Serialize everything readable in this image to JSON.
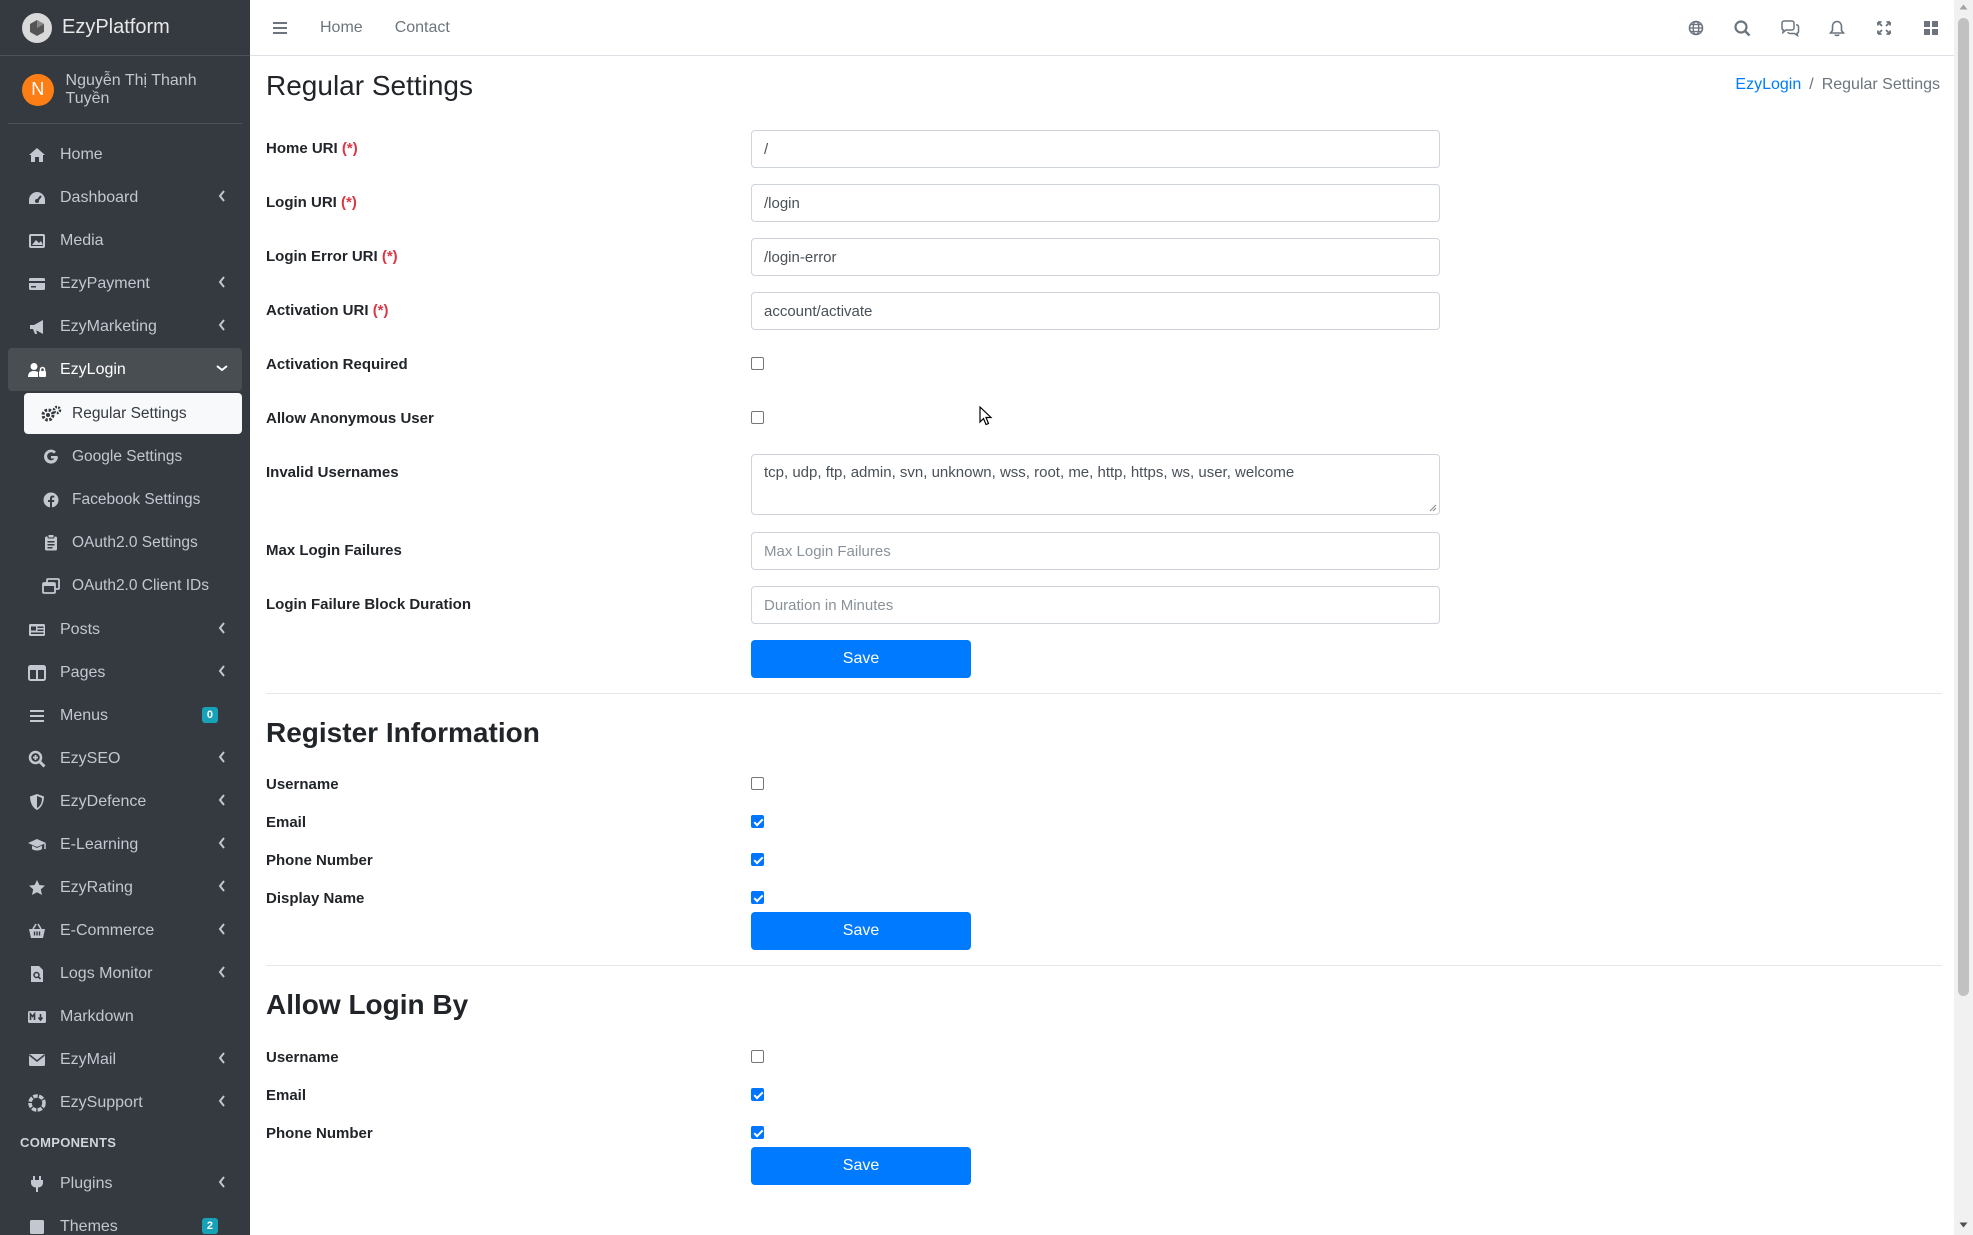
{
  "brand": {
    "name": "EzyPlatform"
  },
  "user": {
    "initial": "N",
    "name": "Nguyễn Thị Thanh Tuyền"
  },
  "sidebar": {
    "items": [
      {
        "label": "Home",
        "icon": "home-icon"
      },
      {
        "label": "Dashboard",
        "icon": "gauge-icon"
      },
      {
        "label": "Media",
        "icon": "image-icon"
      },
      {
        "label": "EzyPayment",
        "icon": "credit-card-icon"
      },
      {
        "label": "EzyMarketing",
        "icon": "megaphone-icon"
      },
      {
        "label": "EzyLogin",
        "icon": "user-lock-icon"
      }
    ],
    "sub_items": [
      {
        "label": "Regular Settings",
        "icon": "gears-icon"
      },
      {
        "label": "Google Settings",
        "icon": "google-icon"
      },
      {
        "label": "Facebook Settings",
        "icon": "facebook-icon"
      },
      {
        "label": "OAuth2.0 Settings",
        "icon": "clipboard-icon"
      },
      {
        "label": "OAuth2.0 Client IDs",
        "icon": "window-restore-icon"
      }
    ],
    "items2": [
      {
        "label": "Posts",
        "icon": "newspaper-icon"
      },
      {
        "label": "Pages",
        "icon": "columns-icon"
      },
      {
        "label": "Menus",
        "icon": "bars-icon",
        "badge": "0"
      },
      {
        "label": "EzySEO",
        "icon": "search-plus-icon"
      },
      {
        "label": "EzyDefence",
        "icon": "shield-icon"
      },
      {
        "label": "E-Learning",
        "icon": "graduation-cap-icon"
      },
      {
        "label": "EzyRating",
        "icon": "star-icon"
      },
      {
        "label": "E-Commerce",
        "icon": "basket-icon"
      },
      {
        "label": "Logs Monitor",
        "icon": "file-search-icon"
      },
      {
        "label": "Markdown",
        "icon": "markdown-icon"
      },
      {
        "label": "EzyMail",
        "icon": "envelope-icon"
      },
      {
        "label": "EzySupport",
        "icon": "life-ring-icon"
      }
    ],
    "components_header": "COMPONENTS",
    "items3": [
      {
        "label": "Plugins",
        "icon": "plug-icon"
      },
      {
        "label": "Themes",
        "icon": "themes-icon",
        "badge": "2"
      }
    ]
  },
  "topbar": {
    "links": [
      "Home",
      "Contact"
    ]
  },
  "page": {
    "title": "Regular Settings"
  },
  "breadcrumb": {
    "parent": "EzyLogin",
    "separator": "/",
    "current": "Regular Settings"
  },
  "regular": {
    "home_uri": {
      "label": "Home URI",
      "value": "/"
    },
    "login_uri": {
      "label": "Login URI",
      "value": "/login"
    },
    "login_error_uri": {
      "label": "Login Error URI",
      "value": "/login-error"
    },
    "activation_uri": {
      "label": "Activation URI",
      "value": "account/activate"
    },
    "activation_required": {
      "label": "Activation Required",
      "checked": false
    },
    "allow_anonymous": {
      "label": "Allow Anonymous User",
      "checked": false
    },
    "invalid_usernames": {
      "label": "Invalid Usernames",
      "value": "tcp, udp, ftp, admin, svn, unknown, wss, root, me, http, https, ws, user, welcome"
    },
    "max_login_failures": {
      "label": "Max Login Failures",
      "placeholder": "Max Login Failures"
    },
    "block_duration": {
      "label": "Login Failure Block Duration",
      "placeholder": "Duration in Minutes"
    },
    "save_label": "Save",
    "required_mark": "(*)"
  },
  "register": {
    "title": "Register Information",
    "username": {
      "label": "Username",
      "checked": false
    },
    "email": {
      "label": "Email",
      "checked": true
    },
    "phone": {
      "label": "Phone Number",
      "checked": true
    },
    "display_name": {
      "label": "Display Name",
      "checked": true
    },
    "save_label": "Save"
  },
  "allow_login": {
    "title": "Allow Login By",
    "username": {
      "label": "Username",
      "checked": false
    },
    "email": {
      "label": "Email",
      "checked": true
    },
    "phone": {
      "label": "Phone Number",
      "checked": true
    },
    "save_label": "Save"
  },
  "colors": {
    "sidebar_bg": "#343a40",
    "primary": "#007bff",
    "required": "#dc3545",
    "avatar": "#fd7e14",
    "badge": "#17a2b8"
  }
}
